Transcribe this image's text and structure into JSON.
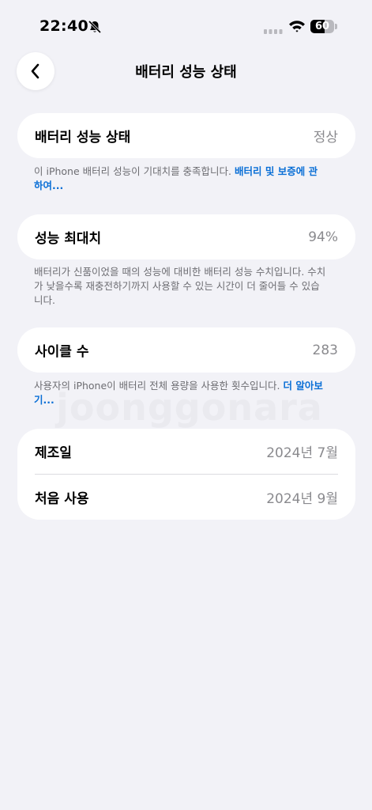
{
  "status_bar": {
    "time": "22:40",
    "battery_level": "60",
    "battery_fraction": 0.6,
    "icons": [
      "bell-slash-icon",
      "cellular-signal-icon",
      "wifi-icon",
      "battery-icon"
    ]
  },
  "nav": {
    "title": "배터리 성능 상태",
    "back_icon": "chevron-left-icon"
  },
  "battery_health": {
    "label": "배터리 성능 상태",
    "value": "정상",
    "caption": "이 iPhone 배터리 성능이 기대치를 충족합니다.",
    "caption_link": "배터리 및 보증에 관하여..."
  },
  "max_capacity": {
    "label": "성능 최대치",
    "value": "94%",
    "caption": "배터리가 신품이었을 때의 성능에 대비한 배터리 성능 수치입니다. 수치가 낮을수록 재충전하기까지 사용할 수 있는 시간이 더 줄어들 수 있습니다."
  },
  "cycle_count": {
    "label": "사이클 수",
    "value": "283",
    "caption": "사용자의 iPhone이 배터리 전체 용량을 사용한 횟수입니다.",
    "caption_link": "더 알아보기..."
  },
  "dates": {
    "manufacture_label": "제조일",
    "manufacture_value": "2024년 7월",
    "first_use_label": "처음 사용",
    "first_use_value": "2024년 9월"
  },
  "watermark": "joonggonara",
  "colors": {
    "background": "#f2f2f7",
    "card": "#ffffff",
    "link": "#0a6fd6",
    "secondary_text": "#8a8a8e"
  }
}
